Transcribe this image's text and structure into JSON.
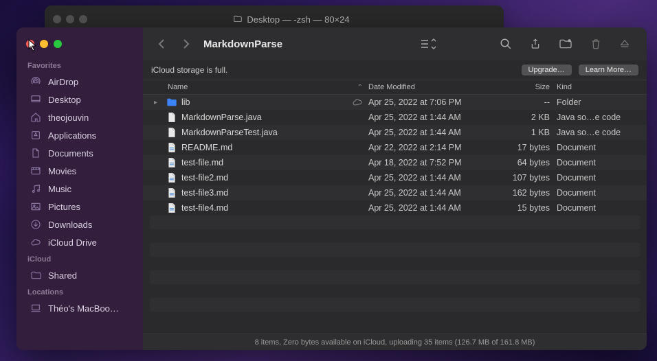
{
  "terminal": {
    "title": "Desktop — -zsh — 80×24"
  },
  "window": {
    "title": "MarkdownParse"
  },
  "sidebar": {
    "sections": [
      {
        "label": "Favorites",
        "items": [
          {
            "icon": "airdrop",
            "label": "AirDrop"
          },
          {
            "icon": "desktop",
            "label": "Desktop"
          },
          {
            "icon": "house",
            "label": "theojouvin"
          },
          {
            "icon": "apps",
            "label": "Applications"
          },
          {
            "icon": "doc",
            "label": "Documents"
          },
          {
            "icon": "movies",
            "label": "Movies"
          },
          {
            "icon": "music",
            "label": "Music"
          },
          {
            "icon": "pics",
            "label": "Pictures"
          },
          {
            "icon": "downloads",
            "label": "Downloads"
          },
          {
            "icon": "cloud",
            "label": "iCloud Drive"
          }
        ]
      },
      {
        "label": "iCloud",
        "items": [
          {
            "icon": "shared",
            "label": "Shared"
          }
        ]
      },
      {
        "label": "Locations",
        "items": [
          {
            "icon": "laptop",
            "label": "Théo's MacBoo…"
          }
        ]
      }
    ]
  },
  "banner": {
    "text": "iCloud storage is full.",
    "upgrade": "Upgrade…",
    "learn": "Learn More…"
  },
  "columns": {
    "name": "Name",
    "date": "Date Modified",
    "size": "Size",
    "kind": "Kind"
  },
  "files": [
    {
      "name": "lib",
      "icon": "folder",
      "disclosure": true,
      "cloud": true,
      "date": "Apr 25, 2022 at 7:06 PM",
      "size": "--",
      "kind": "Folder"
    },
    {
      "name": "MarkdownParse.java",
      "icon": "file",
      "date": "Apr 25, 2022 at 1:44 AM",
      "size": "2 KB",
      "kind": "Java so…e code"
    },
    {
      "name": "MarkdownParseTest.java",
      "icon": "file",
      "date": "Apr 25, 2022 at 1:44 AM",
      "size": "1 KB",
      "kind": "Java so…e code"
    },
    {
      "name": "README.md",
      "icon": "md",
      "date": "Apr 22, 2022 at 2:14 PM",
      "size": "17 bytes",
      "kind": "Document"
    },
    {
      "name": "test-file.md",
      "icon": "md",
      "date": "Apr 18, 2022 at 7:52 PM",
      "size": "64 bytes",
      "kind": "Document"
    },
    {
      "name": "test-file2.md",
      "icon": "md",
      "date": "Apr 25, 2022 at 1:44 AM",
      "size": "107 bytes",
      "kind": "Document"
    },
    {
      "name": "test-file3.md",
      "icon": "md",
      "date": "Apr 25, 2022 at 1:44 AM",
      "size": "162 bytes",
      "kind": "Document"
    },
    {
      "name": "test-file4.md",
      "icon": "md",
      "date": "Apr 25, 2022 at 1:44 AM",
      "size": "15 bytes",
      "kind": "Document"
    }
  ],
  "status": "8 items, Zero bytes available on iCloud, uploading 35 items (126.7 MB of 161.8 MB)"
}
